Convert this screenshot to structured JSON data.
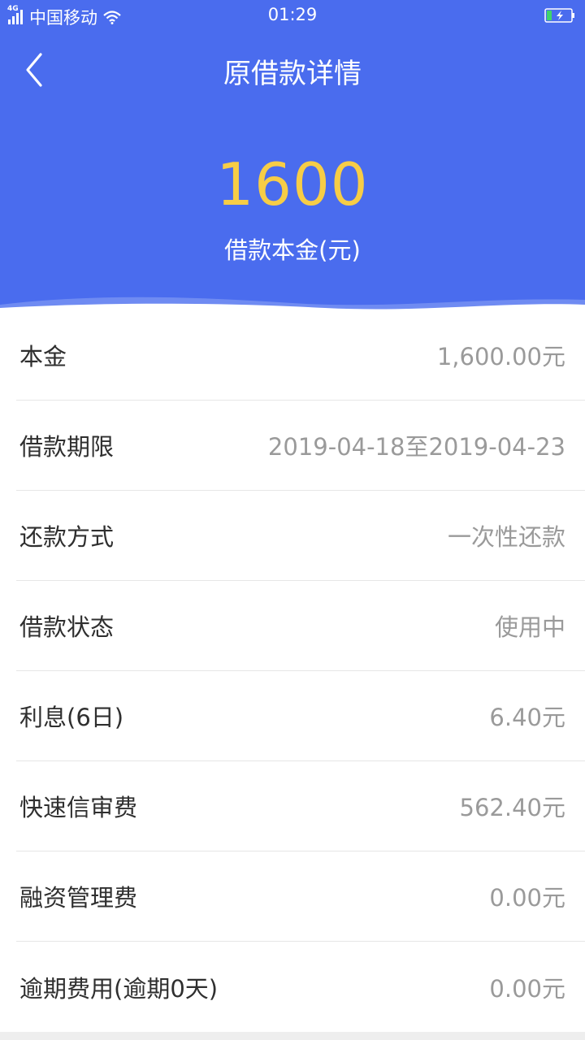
{
  "status_bar": {
    "network": "4G",
    "carrier": "中国移动",
    "time": "01:29"
  },
  "header": {
    "title": "原借款详情",
    "amount": "1600",
    "amount_label": "借款本金(元)",
    "colors": {
      "background": "#4a6cee",
      "amount": "#f7cd46"
    }
  },
  "details": [
    {
      "label": "本金",
      "value": "1,600.00元"
    },
    {
      "label": "借款期限",
      "value": "2019-04-18至2019-04-23"
    },
    {
      "label": "还款方式",
      "value": "一次性还款"
    },
    {
      "label": "借款状态",
      "value": "使用中"
    },
    {
      "label": "利息(6日)",
      "value": "6.40元"
    },
    {
      "label": "快速信审费",
      "value": "562.40元"
    },
    {
      "label": "融资管理费",
      "value": "0.00元"
    },
    {
      "label": "逾期费用(逾期0天)",
      "value": "0.00元"
    }
  ],
  "icons": {
    "back": "chevron-left-icon",
    "signal": "signal-icon",
    "wifi": "wifi-icon",
    "battery": "battery-charging-icon"
  }
}
